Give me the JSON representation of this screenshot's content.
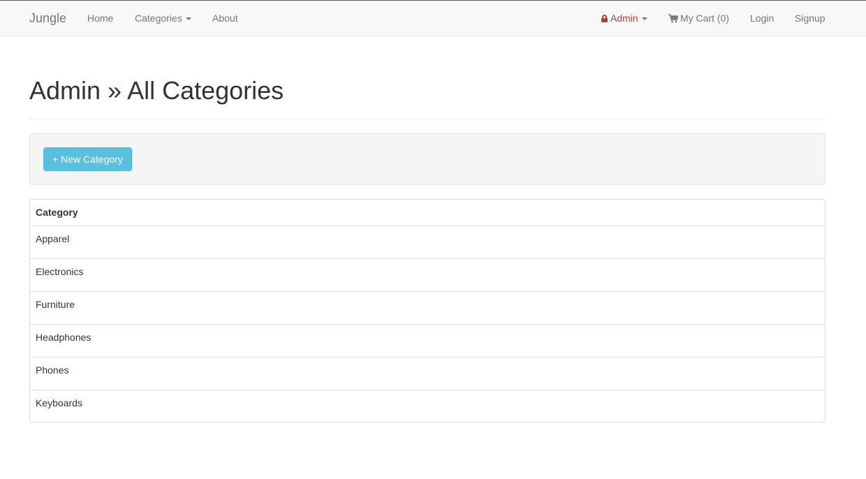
{
  "nav": {
    "brand": "Jungle",
    "home": "Home",
    "categories": "Categories",
    "about": "About",
    "admin": "Admin",
    "cart": "My Cart (0)",
    "login": "Login",
    "signup": "Signup"
  },
  "page": {
    "title": "Admin » All Categories"
  },
  "toolbar": {
    "new_category": "+ New Category"
  },
  "table": {
    "header": "Category",
    "rows": [
      "Apparel",
      "Electronics",
      "Furniture",
      "Headphones",
      "Phones",
      "Keyboards"
    ]
  },
  "colors": {
    "navbar_bg": "#f8f8f8",
    "admin_link": "#a94442",
    "button_info": "#5bc0de",
    "well_bg": "#f5f5f5"
  },
  "icons": {
    "admin": "lock-icon",
    "cart": "shopping-cart-icon",
    "dropdown": "caret-down-icon"
  }
}
